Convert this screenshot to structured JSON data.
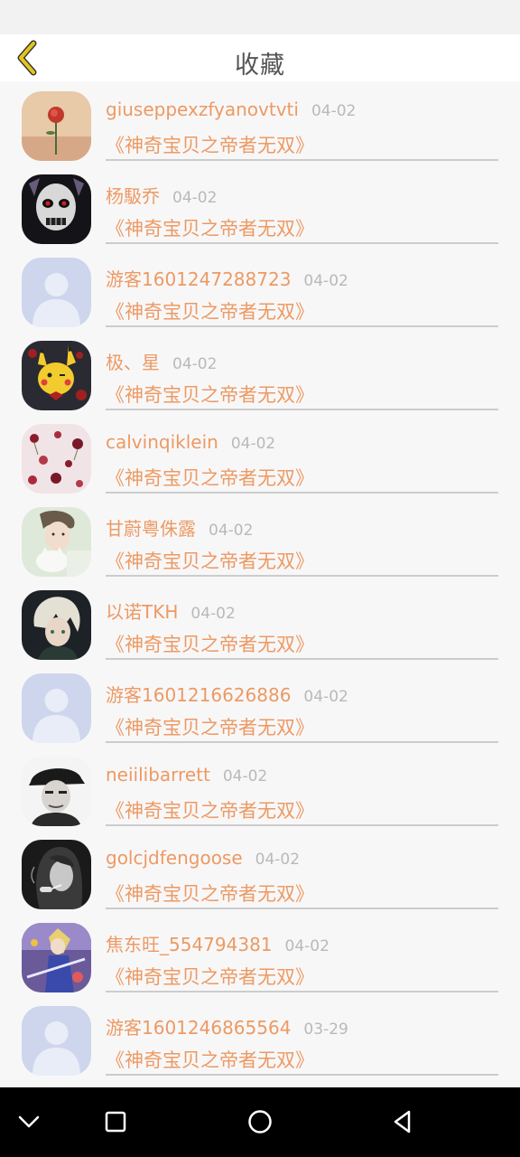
{
  "header": {
    "title": "收藏"
  },
  "colors": {
    "accent": "#ec9a63",
    "date": "#b9b9b9",
    "back_arrow": "#e3c51a"
  },
  "items": [
    {
      "name": "giuseppexzfyanovtvti",
      "date": "04-02",
      "book": "《神奇宝贝之帝者无双》",
      "avatar": "rose-avatar"
    },
    {
      "name": "杨馺乔",
      "date": "04-02",
      "book": "《神奇宝贝之帝者无双》",
      "avatar": "skull-avatar"
    },
    {
      "name": "游客1601247288723",
      "date": "04-02",
      "book": "《神奇宝贝之帝者无双》",
      "avatar": "default-user-avatar"
    },
    {
      "name": "极、星",
      "date": "04-02",
      "book": "《神奇宝贝之帝者无双》",
      "avatar": "pikachu-avatar"
    },
    {
      "name": "calvinqiklein",
      "date": "04-02",
      "book": "《神奇宝贝之帝者无双》",
      "avatar": "flowers-avatar"
    },
    {
      "name": "甘蔚粤侏露",
      "date": "04-02",
      "book": "《神奇宝贝之帝者无双》",
      "avatar": "person-cat-avatar"
    },
    {
      "name": "以诺TKH",
      "date": "04-02",
      "book": "《神奇宝贝之帝者无双》",
      "avatar": "anime-avatar"
    },
    {
      "name": "游客1601216626886",
      "date": "04-02",
      "book": "《神奇宝贝之帝者无双》",
      "avatar": "default-user-avatar"
    },
    {
      "name": "neiilibarrett",
      "date": "04-02",
      "book": "《神奇宝贝之帝者无双》",
      "avatar": "man-hat-avatar"
    },
    {
      "name": "golcjdfengoose",
      "date": "04-02",
      "book": "《神奇宝贝之帝者无双》",
      "avatar": "woman-smoking-avatar"
    },
    {
      "name": "焦东旺_554794381",
      "date": "04-02",
      "book": "《神奇宝贝之帝者无双》",
      "avatar": "game-character-avatar"
    },
    {
      "name": "游客1601246865564",
      "date": "03-29",
      "book": "《神奇宝贝之帝者无双》",
      "avatar": "default-user-avatar"
    }
  ]
}
